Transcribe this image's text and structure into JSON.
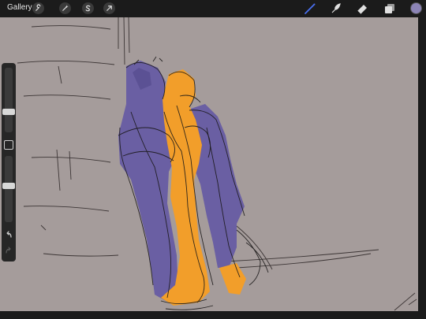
{
  "topbar": {
    "gallery_label": "Gallery",
    "left_tools": [
      "wrench-icon",
      "magic-wand-icon",
      "selection-icon",
      "transform-arrow-icon"
    ],
    "right_tools": [
      "brush-icon",
      "smudge-icon",
      "eraser-icon",
      "layers-icon"
    ],
    "active_tool": "brush-icon",
    "brush_color": "#8c84b6",
    "color_swatch": "#8c84b6"
  },
  "canvas": {
    "background": "#a59c9b",
    "purple_figure": "#6a5fa3",
    "orange_figure": "#f29e2a",
    "line_color": "#1a1818"
  },
  "sidebar": {
    "brush_size_level": 0.3,
    "opacity_level": 0.55,
    "undo_icon": "undo-icon",
    "redo_icon": "redo-icon"
  }
}
